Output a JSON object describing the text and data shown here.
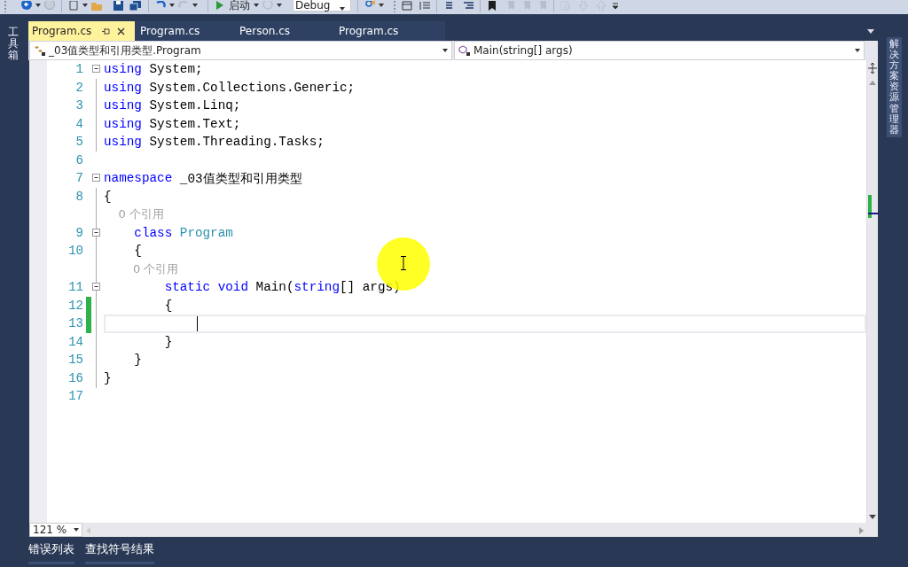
{
  "toolbar": {
    "start_label": "启动",
    "configuration": "Debug"
  },
  "tool_windows": {
    "left": "工具箱",
    "right": "解决方案资源管理器"
  },
  "tabs": [
    {
      "label": "Program.cs",
      "selected": true
    },
    {
      "label": "Program.cs",
      "selected": false
    },
    {
      "label": "Person.cs",
      "selected": false
    },
    {
      "label": "Program.cs",
      "selected": false
    }
  ],
  "navigation": {
    "type_scope": "_03值类型和引用类型.Program",
    "member_scope": "Main(string[] args)"
  },
  "editor": {
    "lines": [
      {
        "kind": "code",
        "number": "1",
        "collapsible": true,
        "in_block": false,
        "changed": false,
        "current": false,
        "tokens": [
          {
            "kind": "keyword",
            "text": "using"
          },
          {
            "kind": "plain",
            "text": " System;"
          }
        ]
      },
      {
        "kind": "code",
        "number": "2",
        "collapsible": false,
        "in_block": true,
        "changed": false,
        "current": false,
        "tokens": [
          {
            "kind": "keyword",
            "text": "using"
          },
          {
            "kind": "plain",
            "text": " System.Collections.Generic;"
          }
        ]
      },
      {
        "kind": "code",
        "number": "3",
        "collapsible": false,
        "in_block": true,
        "changed": false,
        "current": false,
        "tokens": [
          {
            "kind": "keyword",
            "text": "using"
          },
          {
            "kind": "plain",
            "text": " System.Linq;"
          }
        ]
      },
      {
        "kind": "code",
        "number": "4",
        "collapsible": false,
        "in_block": true,
        "changed": false,
        "current": false,
        "tokens": [
          {
            "kind": "keyword",
            "text": "using"
          },
          {
            "kind": "plain",
            "text": " System.Text;"
          }
        ]
      },
      {
        "kind": "code",
        "number": "5",
        "collapsible": false,
        "in_block": true,
        "changed": false,
        "current": false,
        "tokens": [
          {
            "kind": "keyword",
            "text": "using"
          },
          {
            "kind": "plain",
            "text": " System.Threading.Tasks;"
          }
        ]
      },
      {
        "kind": "code",
        "number": "6",
        "collapsible": false,
        "in_block": false,
        "changed": false,
        "current": false
      },
      {
        "kind": "code",
        "number": "7",
        "collapsible": true,
        "in_block": false,
        "changed": false,
        "current": false,
        "tokens": [
          {
            "kind": "keyword",
            "text": "namespace"
          },
          {
            "kind": "plain",
            "text": " _03值类型和引用类型"
          }
        ]
      },
      {
        "kind": "code",
        "number": "8",
        "collapsible": false,
        "in_block": true,
        "changed": false,
        "current": false,
        "tokens": [
          {
            "kind": "plain",
            "text": "{"
          }
        ]
      },
      {
        "kind": "lens",
        "collapsible": false,
        "in_block": true,
        "tokens": [
          {
            "kind": "lens",
            "text": "    0 个引用"
          }
        ]
      },
      {
        "kind": "code",
        "number": "9",
        "collapsible": true,
        "in_block": true,
        "changed": false,
        "current": false,
        "tokens": [
          {
            "kind": "keyword",
            "text": "    class"
          },
          {
            "kind": "type",
            "text": " Program"
          }
        ]
      },
      {
        "kind": "code",
        "number": "10",
        "collapsible": false,
        "in_block": true,
        "changed": false,
        "current": false,
        "tokens": [
          {
            "kind": "plain",
            "text": "    {"
          }
        ]
      },
      {
        "kind": "lens",
        "collapsible": false,
        "in_block": true,
        "tokens": [
          {
            "kind": "lens",
            "text": "        0 个引用"
          }
        ]
      },
      {
        "kind": "code",
        "number": "11",
        "collapsible": true,
        "in_block": true,
        "changed": false,
        "current": false,
        "tokens": [
          {
            "kind": "keyword",
            "text": "        static void"
          },
          {
            "kind": "plain",
            "text": " Main("
          },
          {
            "kind": "keyword",
            "text": "string"
          },
          {
            "kind": "plain",
            "text": "[] args)"
          }
        ]
      },
      {
        "kind": "code",
        "number": "12",
        "collapsible": false,
        "in_block": true,
        "changed": true,
        "current": false,
        "tokens": [
          {
            "kind": "plain",
            "text": "        {"
          }
        ]
      },
      {
        "kind": "code",
        "number": "13",
        "collapsible": false,
        "in_block": true,
        "changed": true,
        "current": true
      },
      {
        "kind": "code",
        "number": "14",
        "collapsible": false,
        "in_block": true,
        "changed": false,
        "current": false,
        "tokens": [
          {
            "kind": "plain",
            "text": "        }"
          }
        ]
      },
      {
        "kind": "code",
        "number": "15",
        "collapsible": false,
        "in_block": true,
        "changed": false,
        "current": false,
        "tokens": [
          {
            "kind": "plain",
            "text": "    }"
          }
        ]
      },
      {
        "kind": "code",
        "number": "16",
        "collapsible": false,
        "in_block": true,
        "changed": false,
        "current": false,
        "tokens": [
          {
            "kind": "plain",
            "text": "}"
          }
        ]
      },
      {
        "kind": "code",
        "number": "17",
        "collapsible": false,
        "in_block": false,
        "changed": false,
        "current": false
      }
    ]
  },
  "zoom": "121 %",
  "bottom_tabs": [
    "错误列表",
    "查找符号结果"
  ]
}
